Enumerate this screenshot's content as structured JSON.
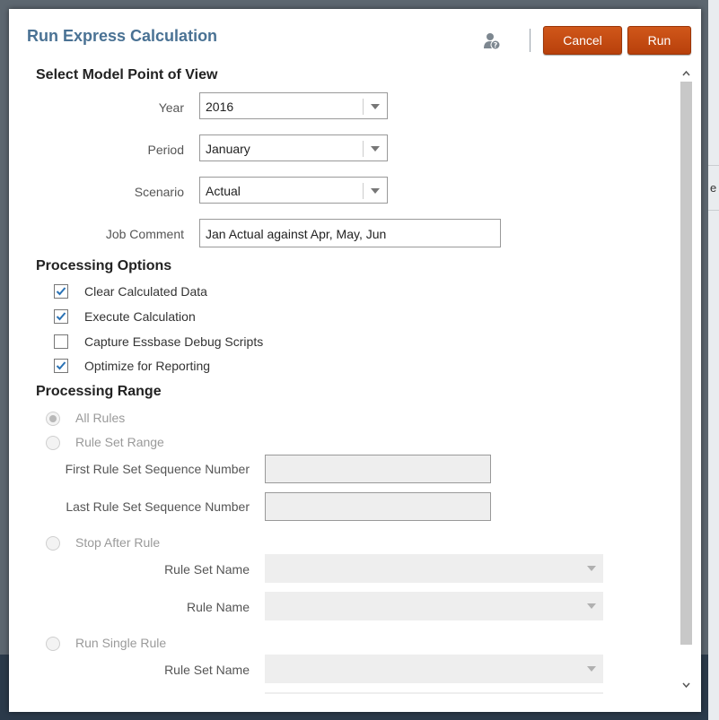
{
  "dialog": {
    "title": "Run Express Calculation",
    "help_icon": "person-question-icon",
    "cancel_label": "Cancel",
    "run_label": "Run",
    "accent_color": "#c24c12"
  },
  "background": {
    "partial_text": "e"
  },
  "pov": {
    "title": "Select Model Point of View",
    "year": {
      "label": "Year",
      "value": "2016"
    },
    "period": {
      "label": "Period",
      "value": "January"
    },
    "scenario": {
      "label": "Scenario",
      "value": "Actual"
    },
    "job_comment": {
      "label": "Job Comment",
      "value": "Jan Actual against Apr, May, Jun"
    }
  },
  "processing_options": {
    "title": "Processing Options",
    "items": [
      {
        "label": "Clear Calculated Data",
        "checked": true
      },
      {
        "label": "Execute Calculation",
        "checked": true
      },
      {
        "label": "Capture Essbase Debug Scripts",
        "checked": false
      },
      {
        "label": "Optimize for Reporting",
        "checked": true
      }
    ]
  },
  "processing_range": {
    "title": "Processing Range",
    "all_rules": "All Rules",
    "rule_set_range": "Rule Set Range",
    "first_seq_label": "First Rule Set Sequence Number",
    "last_seq_label": "Last Rule Set Sequence Number",
    "stop_after_rule": "Stop After Rule",
    "rule_set_name_label": "Rule Set Name",
    "rule_name_label": "Rule Name",
    "run_single_rule": "Run Single Rule",
    "single_rule_set_name_label": "Rule Set Name",
    "selected": "All Rules"
  }
}
